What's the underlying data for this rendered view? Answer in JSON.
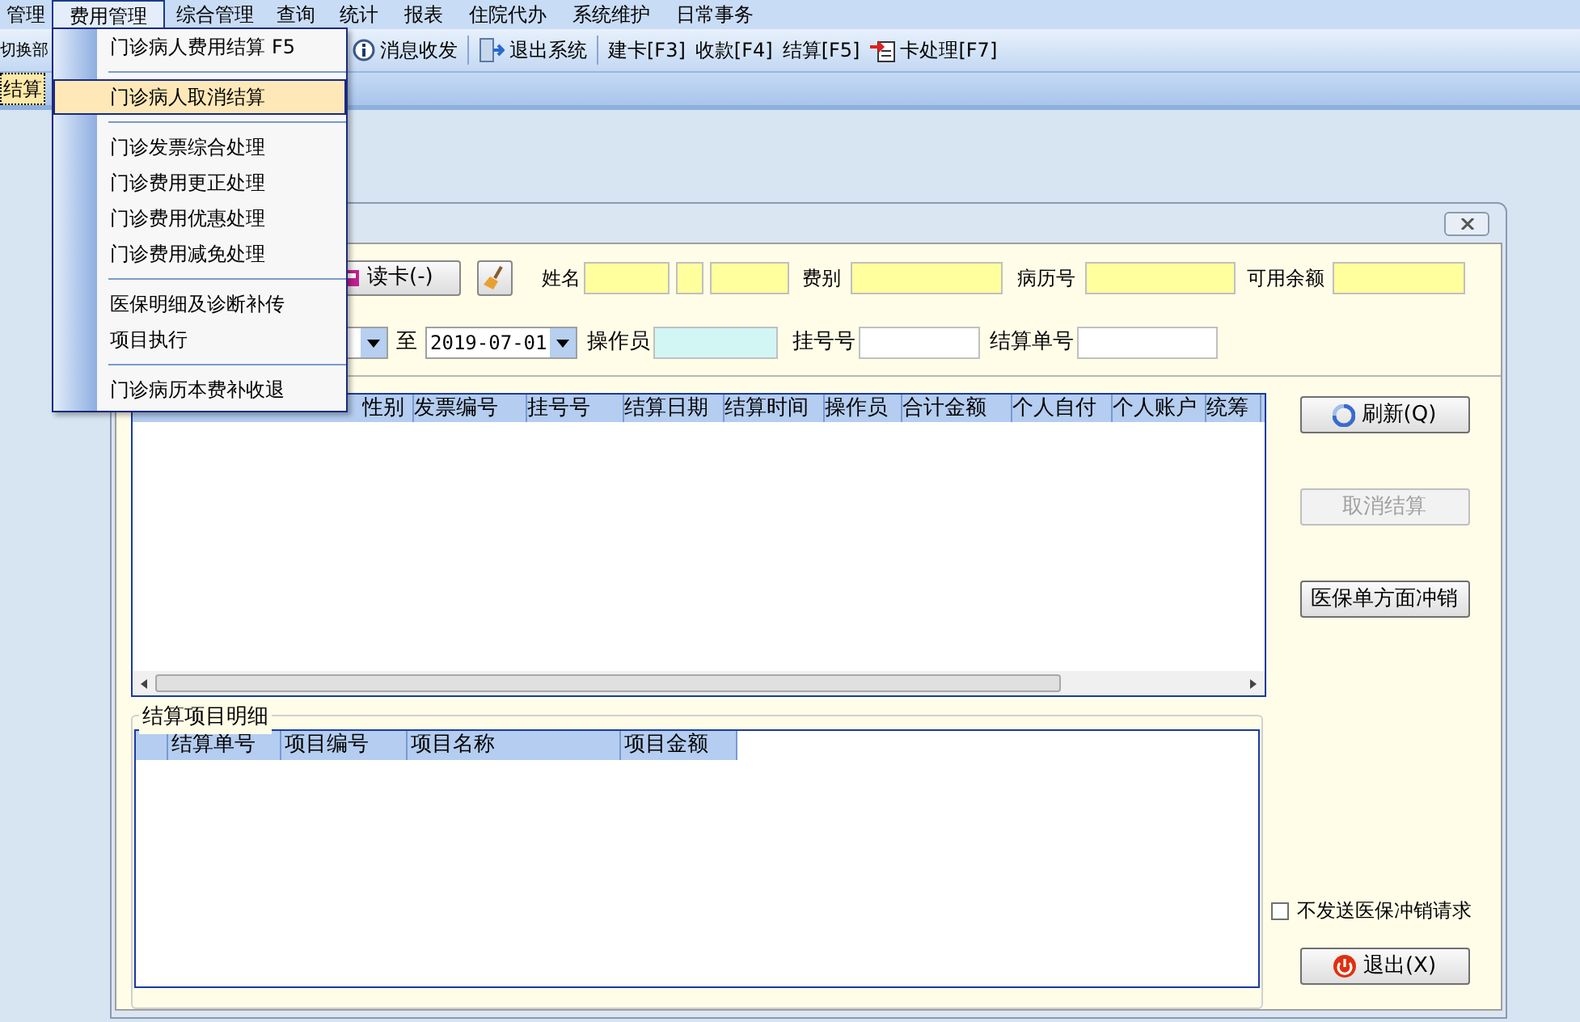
{
  "menu_bar": {
    "items": [
      {
        "label": "管理",
        "selected": false
      },
      {
        "label": "费用管理",
        "selected": true
      },
      {
        "label": "综合管理",
        "selected": false
      },
      {
        "label": "查询",
        "selected": false
      },
      {
        "label": "统计",
        "selected": false
      },
      {
        "label": "报表",
        "selected": false
      },
      {
        "label": "住院代办",
        "selected": false
      },
      {
        "label": "系统维护",
        "selected": false
      },
      {
        "label": "日常事务",
        "selected": false
      }
    ]
  },
  "toolbar": {
    "cut_item": "切换部",
    "items": [
      {
        "label": "消息收发",
        "kind": "info"
      },
      {
        "label": "退出系统",
        "kind": "door"
      },
      {
        "label": "建卡[F3]",
        "kind": "text"
      },
      {
        "label": "收款[F4]",
        "kind": "text"
      },
      {
        "label": "结算[F5]",
        "kind": "text"
      },
      {
        "label": "卡处理[F7]",
        "kind": "card"
      }
    ]
  },
  "tabs": [
    {
      "label": "结算",
      "selected": true
    }
  ],
  "dropdown": {
    "groups": [
      [
        {
          "label": "门诊病人费用结算",
          "shortcut": "F5",
          "selected": false
        }
      ],
      [
        {
          "label": "门诊病人取消结算",
          "selected": true
        }
      ],
      [
        {
          "label": "门诊发票综合处理",
          "selected": false
        },
        {
          "label": "门诊费用更正处理",
          "selected": false
        },
        {
          "label": "门诊费用优惠处理",
          "selected": false
        },
        {
          "label": "门诊费用减免处理",
          "selected": false
        }
      ],
      [
        {
          "label": "医保明细及诊断补传",
          "selected": false
        },
        {
          "label": "项目执行",
          "selected": false
        }
      ],
      [
        {
          "label": "门诊病历本费补收退",
          "selected": false
        }
      ]
    ]
  },
  "dialog": {
    "read_card_button": "读卡(-)",
    "name_label": "姓名",
    "fee_type_label": "费别",
    "record_no_label": "病历号",
    "balance_label": "可用余额",
    "to_label": "至",
    "date_to": "2019-07-01",
    "operator_label": "操作员",
    "register_no_label": "挂号号",
    "settlement_no_label": "结算单号",
    "settlement_table": {
      "columns": [
        "性别",
        "发票编号",
        "挂号号",
        "结算日期",
        "结算时间",
        "操作员",
        "合计金额",
        "个人自付",
        "个人账户",
        "统筹"
      ]
    },
    "detail_group": {
      "title": "结算项目明细",
      "columns": [
        "结算单号",
        "项目编号",
        "项目名称",
        "项目金额"
      ]
    },
    "buttons": [
      {
        "label": "刷新(Q)",
        "kind": "refresh",
        "disabled": false
      },
      {
        "label": "取消结算",
        "kind": "plain",
        "disabled": true
      },
      {
        "label": "医保单方面冲销",
        "kind": "plain",
        "disabled": false
      }
    ],
    "no_send_checkbox": {
      "label": "不发送医保冲销请求",
      "checked": false
    },
    "exit_button": "退出(X)"
  }
}
